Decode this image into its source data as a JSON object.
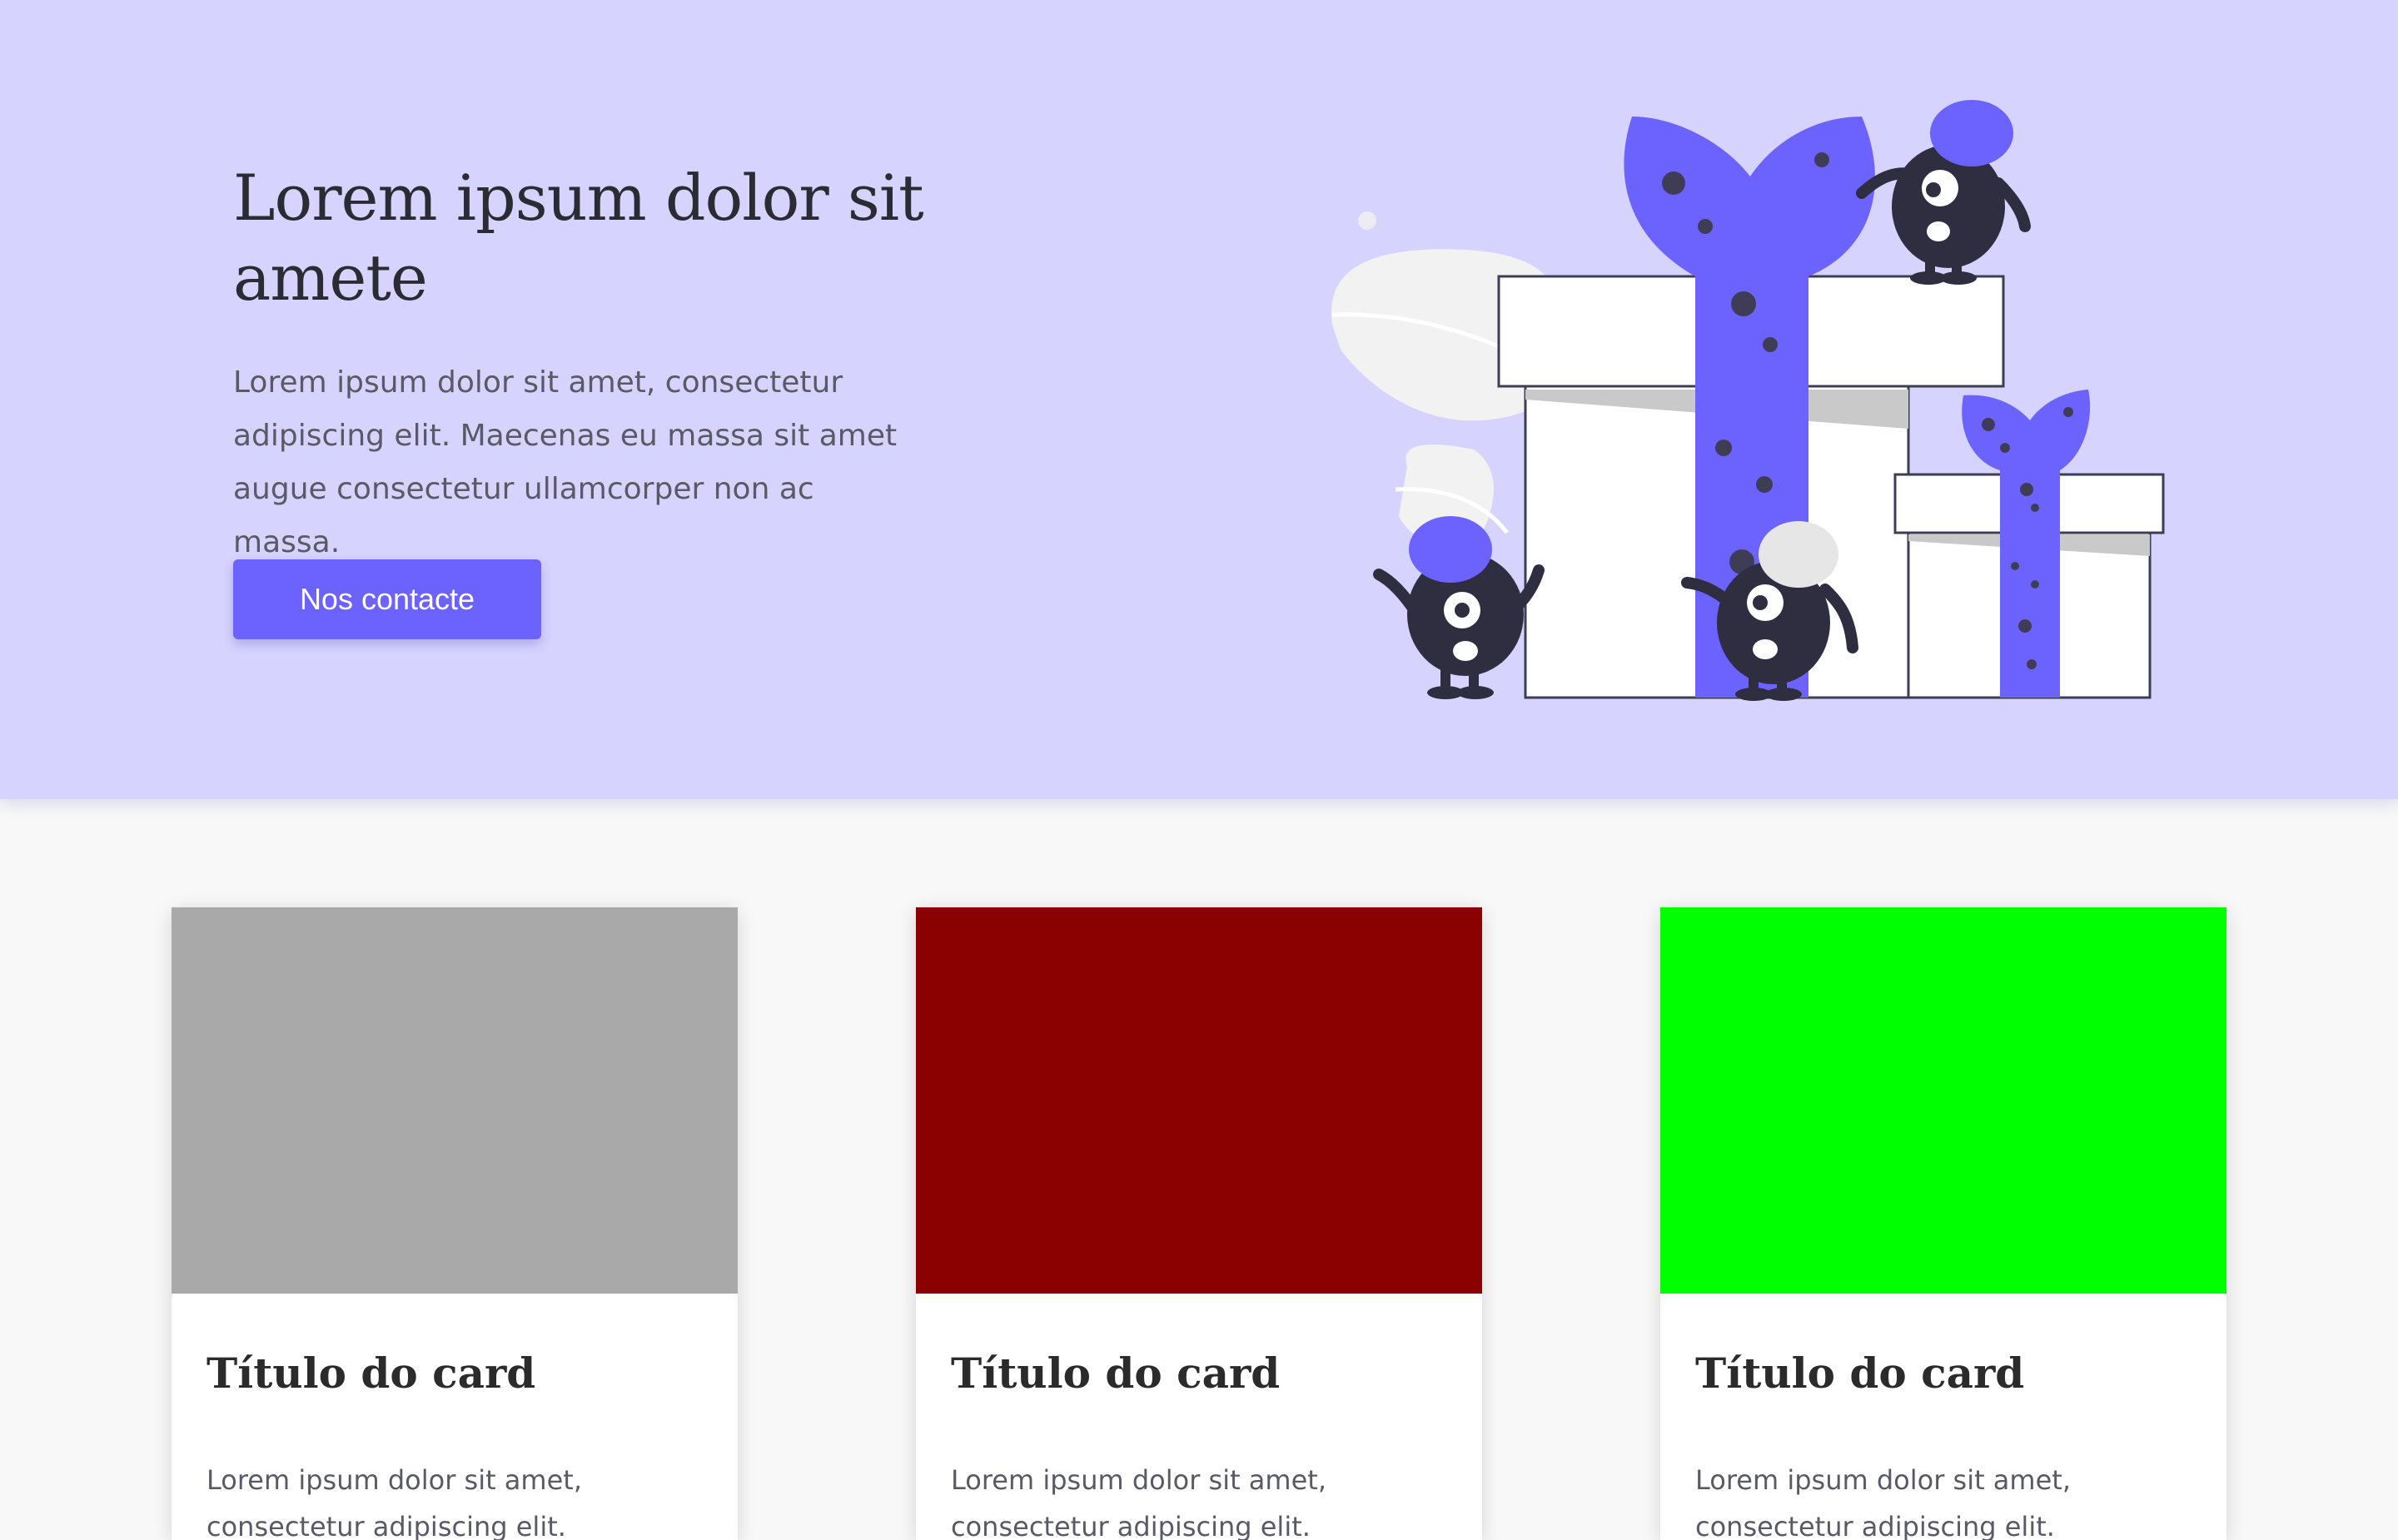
{
  "hero": {
    "title": "Lorem ipsum dolor sit amete",
    "text": "Lorem ipsum dolor sit amet, consectetur adipiscing elit. Maecenas eu massa sit amet augue consectetur ullamcorper non ac massa.",
    "button_label": "Nos contacte",
    "accent_color": "#6c63ff",
    "background_color": "#d6d3ff",
    "illustration": "gift-boxes-with-monsters-illustration"
  },
  "cards": [
    {
      "image_color": "#a9a9a9",
      "title": "Título do card",
      "text": "Lorem ipsum dolor sit amet, consectetur adipiscing elit. Vestibulum in neque et nisl"
    },
    {
      "image_color": "#8b0000",
      "title": "Título do card",
      "text": "Lorem ipsum dolor sit amet, consectetur adipiscing elit. Vestibulum in neque et nisl"
    },
    {
      "image_color": "#00ff00",
      "title": "Título do card",
      "text": "Lorem ipsum dolor sit amet, consectetur adipiscing elit. Vestibulum in neque et nisl"
    }
  ]
}
